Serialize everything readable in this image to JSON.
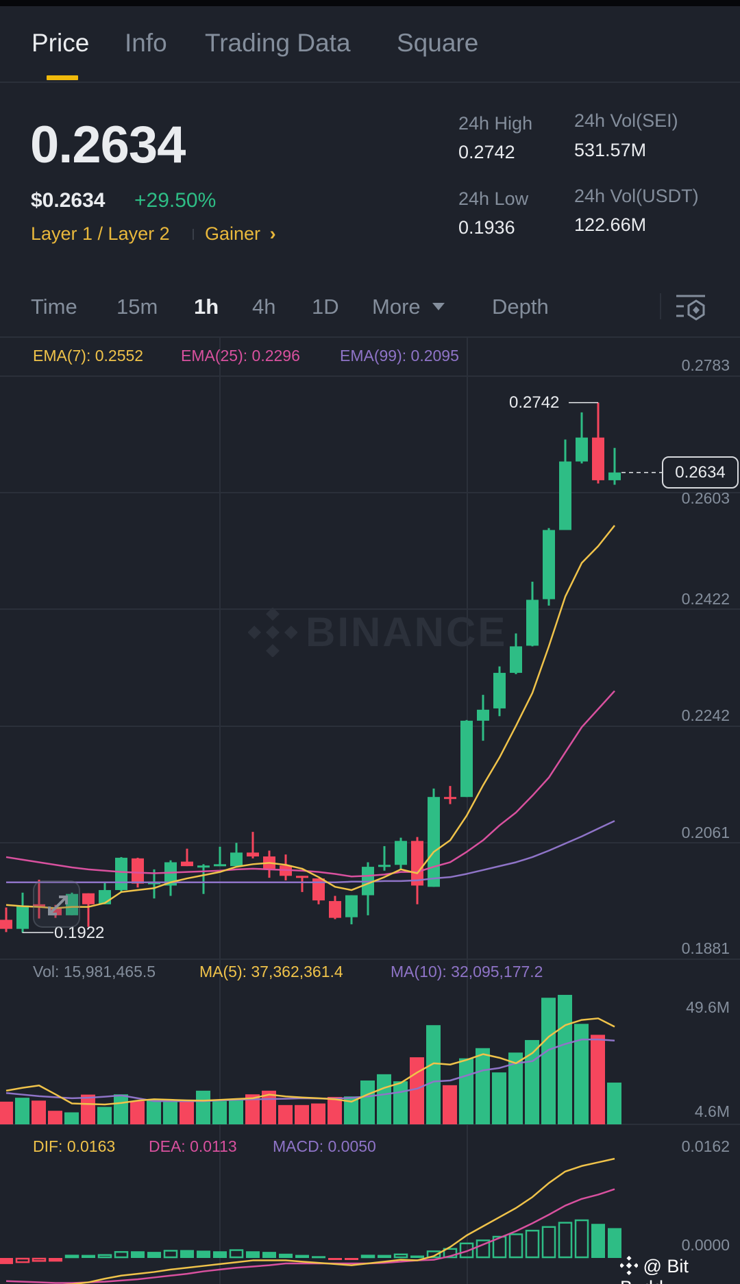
{
  "tabs": [
    {
      "label": "Price",
      "active": true
    },
    {
      "label": "Info"
    },
    {
      "label": "Trading Data"
    },
    {
      "label": "Square"
    }
  ],
  "ticker": {
    "last_price": "0.2634",
    "usd_price": "$0.2634",
    "change_pct": "+29.50%",
    "tag_category": "Layer 1 / Layer 2",
    "tag_gainer": "Gainer",
    "chevron": "›"
  },
  "stats": {
    "high_label": "24h High",
    "high_value": "0.2742",
    "low_label": "24h Low",
    "low_value": "0.1936",
    "vol_base_label": "24h Vol(SEI)",
    "vol_base_value": "531.57M",
    "vol_quote_label": "24h Vol(USDT)",
    "vol_quote_value": "122.66M"
  },
  "timeframes": {
    "time": "Time",
    "m15": "15m",
    "h1": "1h",
    "h4": "4h",
    "d1": "1D",
    "more": "More",
    "depth": "Depth",
    "active": "1h"
  },
  "indicators": {
    "ema7": "EMA(7): 0.2552",
    "ema25": "EMA(25): 0.2296",
    "ema99": "EMA(99): 0.2095",
    "vol": "Vol: 15,981,465.5",
    "ma5": "MA(5): 37,362,361.4",
    "ma10": "MA(10): 32,095,177.2",
    "dif": "DIF: 0.0163",
    "dea": "DEA: 0.0113",
    "macd": "MACD: 0.0050"
  },
  "watermark": "BINANCE",
  "credit": "@ Bit Buddy",
  "colors": {
    "up": "#2ebd85",
    "down": "#f6465d",
    "accent": "#f0b90b",
    "ema7": "#f0c34a",
    "ema25": "#d9519f",
    "ema99": "#8f74c8"
  },
  "chart_data": {
    "type": "candlestick",
    "interval": "1h",
    "y_ticks": [
      "0.2783",
      "0.2603",
      "0.2422",
      "0.2242",
      "0.2061",
      "0.1881"
    ],
    "ylim": [
      0.1881,
      0.2783
    ],
    "high_marker": "0.2742",
    "low_marker": "0.1922",
    "last_price_tag": "0.2634",
    "candles": [
      [
        0.1942,
        0.1961,
        0.1923,
        0.1928
      ],
      [
        0.1928,
        0.1984,
        0.1922,
        0.1964
      ],
      [
        0.1966,
        0.2004,
        0.1944,
        0.1962
      ],
      [
        0.1961,
        0.1965,
        0.1945,
        0.1949
      ],
      [
        0.1949,
        0.1984,
        0.1949,
        0.1982
      ],
      [
        0.1983,
        0.1983,
        0.1931,
        0.1966
      ],
      [
        0.1966,
        0.2,
        0.1966,
        0.1988
      ],
      [
        0.1988,
        0.2039,
        0.1984,
        0.2038
      ],
      [
        0.2037,
        0.2038,
        0.1992,
        0.1998
      ],
      [
        0.1997,
        0.202,
        0.1975,
        0.2001
      ],
      [
        0.1995,
        0.2034,
        0.1979,
        0.2031
      ],
      [
        0.2032,
        0.2052,
        0.2025,
        0.2025
      ],
      [
        0.2023,
        0.2028,
        0.1982,
        0.2026
      ],
      [
        0.2025,
        0.2055,
        0.2025,
        0.2028
      ],
      [
        0.2025,
        0.2061,
        0.2025,
        0.2046
      ],
      [
        0.2046,
        0.2078,
        0.2037,
        0.204
      ],
      [
        0.204,
        0.2049,
        0.2007,
        0.2021
      ],
      [
        0.2026,
        0.2043,
        0.2003,
        0.201
      ],
      [
        0.201,
        0.201,
        0.1985,
        0.2008
      ],
      [
        0.2006,
        0.2006,
        0.1966,
        0.1972
      ],
      [
        0.1971,
        0.1979,
        0.1943,
        0.1945
      ],
      [
        0.1946,
        0.198,
        0.1935,
        0.198
      ],
      [
        0.198,
        0.2031,
        0.1949,
        0.2024
      ],
      [
        0.2024,
        0.2056,
        0.2018,
        0.2027
      ],
      [
        0.2027,
        0.2069,
        0.2019,
        0.2064
      ],
      [
        0.2064,
        0.207,
        0.1966,
        0.1995
      ],
      [
        0.1993,
        0.2145,
        0.1993,
        0.2132
      ],
      [
        0.2132,
        0.2149,
        0.2121,
        0.2131
      ],
      [
        0.2132,
        0.2251,
        0.2132,
        0.225
      ],
      [
        0.225,
        0.229,
        0.2219,
        0.2267
      ],
      [
        0.2269,
        0.2334,
        0.2257,
        0.2324
      ],
      [
        0.2324,
        0.2385,
        0.2322,
        0.2365
      ],
      [
        0.2366,
        0.2465,
        0.2365,
        0.2437
      ],
      [
        0.2438,
        0.2548,
        0.2428,
        0.2545
      ],
      [
        0.2545,
        0.2685,
        0.2545,
        0.2651
      ],
      [
        0.2651,
        0.2727,
        0.2648,
        0.2688
      ],
      [
        0.2688,
        0.2742,
        0.2617,
        0.2622
      ],
      [
        0.2622,
        0.2672,
        0.2615,
        0.2634
      ]
    ],
    "candle_fields": [
      "open",
      "high",
      "low",
      "close"
    ],
    "ema7": [
      0.1965,
      0.1963,
      0.1962,
      0.196,
      0.1962,
      0.1962,
      0.1968,
      0.1985,
      0.1988,
      0.1991,
      0.2,
      0.2006,
      0.2011,
      0.2016,
      0.2024,
      0.2028,
      0.203,
      0.2027,
      0.2021,
      0.2008,
      0.1993,
      0.1988,
      0.1998,
      0.2008,
      0.202,
      0.2014,
      0.2047,
      0.2065,
      0.2103,
      0.215,
      0.2193,
      0.2242,
      0.2293,
      0.2365,
      0.2442,
      0.2494,
      0.252,
      0.2552
    ],
    "ema25": [
      0.2039,
      0.2035,
      0.2031,
      0.2027,
      0.2023,
      0.202,
      0.2018,
      0.2016,
      0.2015,
      0.2014,
      0.2015,
      0.2016,
      0.2017,
      0.2018,
      0.202,
      0.2021,
      0.202,
      0.2019,
      0.2018,
      0.2016,
      0.2013,
      0.2009,
      0.201,
      0.2012,
      0.2016,
      0.2016,
      0.2024,
      0.2031,
      0.2047,
      0.2065,
      0.2088,
      0.2108,
      0.2134,
      0.2162,
      0.2201,
      0.224,
      0.2268,
      0.2296
    ],
    "ema99": [
      0.2,
      0.2,
      0.2,
      0.2,
      0.2,
      0.2,
      0.2,
      0.2,
      0.2,
      0.2,
      0.2,
      0.2,
      0.2,
      0.2,
      0.2,
      0.2,
      0.2,
      0.2,
      0.2,
      0.2,
      0.2,
      0.2001,
      0.2001,
      0.2002,
      0.2002,
      0.2003,
      0.2006,
      0.2008,
      0.2013,
      0.2019,
      0.2025,
      0.2031,
      0.2039,
      0.2049,
      0.206,
      0.2071,
      0.2083,
      0.2095
    ],
    "volume": {
      "unit": "M",
      "y_ticks": [
        "49.6M",
        "4.6M"
      ],
      "values": [
        8.7,
        10.2,
        9.1,
        5.2,
        4.6,
        11.4,
        6.7,
        11.5,
        8.9,
        9.6,
        8.9,
        8.9,
        12.9,
        8.9,
        9.6,
        11.5,
        12.9,
        7.4,
        7.4,
        8.0,
        10.5,
        10.7,
        16.8,
        19.2,
        16.5,
        25.7,
        38.0,
        15.0,
        25.3,
        29.2,
        19.9,
        27.5,
        32.3,
        48.5,
        49.6,
        38.5,
        34.3,
        16.0
      ],
      "ma5": [
        12.9,
        14.0,
        14.9,
        11.5,
        8.0,
        7.8,
        7.6,
        8.2,
        9.1,
        9.6,
        9.4,
        9.2,
        9.1,
        9.4,
        9.7,
        10.0,
        11.4,
        10.7,
        10.3,
        10.0,
        9.6,
        8.7,
        11.5,
        14.0,
        15.9,
        19.9,
        23.4,
        22.9,
        24.7,
        26.9,
        25.5,
        23.4,
        27.3,
        33.6,
        38.0,
        40.0,
        40.6,
        37.4
      ],
      "ma10": [
        12.0,
        11.4,
        10.8,
        10.4,
        10.0,
        10.2,
        10.6,
        11.1,
        10.0,
        8.9,
        8.9,
        8.9,
        8.9,
        9.2,
        9.4,
        9.6,
        9.7,
        9.8,
        10.0,
        9.9,
        9.8,
        10.2,
        10.7,
        11.5,
        12.4,
        13.7,
        16.4,
        16.8,
        18.7,
        20.7,
        21.6,
        23.4,
        24.2,
        28.6,
        30.8,
        32.5,
        32.5,
        32.1
      ]
    },
    "macd": {
      "y_ticks": [
        "0.0162",
        "0.0000"
      ],
      "dif": [
        -0.005,
        -0.0048,
        -0.0046,
        -0.0045,
        -0.0043,
        -0.004,
        -0.0034,
        -0.0029,
        -0.0026,
        -0.0023,
        -0.0019,
        -0.0016,
        -0.0013,
        -0.001,
        -0.0007,
        -0.0004,
        -0.0004,
        -0.0004,
        -0.0006,
        -0.0008,
        -0.001,
        -0.0012,
        -0.0009,
        -0.0006,
        -0.0003,
        -0.0004,
        0.0003,
        0.0018,
        0.0037,
        0.0052,
        0.0067,
        0.0082,
        0.01,
        0.0123,
        0.0142,
        0.0151,
        0.0157,
        0.0163
      ],
      "dea": [
        -0.0038,
        -0.0039,
        -0.004,
        -0.0041,
        -0.0041,
        -0.004,
        -0.0039,
        -0.0037,
        -0.0035,
        -0.0032,
        -0.0029,
        -0.0026,
        -0.0022,
        -0.0019,
        -0.0016,
        -0.0014,
        -0.0012,
        -0.0009,
        -0.0009,
        -0.0009,
        -0.0009,
        -0.0009,
        -0.0009,
        -0.0008,
        -0.0006,
        -0.0004,
        -0.0003,
        0.0003,
        0.0011,
        0.0022,
        0.0033,
        0.0044,
        0.0057,
        0.0071,
        0.0086,
        0.0097,
        0.0104,
        0.0113
      ],
      "hist": [
        -0.001,
        -0.0008,
        -0.0006,
        -0.0006,
        0.0005,
        0.0005,
        0.0006,
        0.0011,
        0.0011,
        0.001,
        0.0013,
        0.0013,
        0.0012,
        0.0011,
        0.0014,
        0.0011,
        0.001,
        0.0007,
        0.0005,
        0.0003,
        -0.0003,
        -0.0003,
        0.0005,
        0.0005,
        0.0007,
        0.0004,
        0.0012,
        0.0016,
        0.0025,
        0.003,
        0.0036,
        0.004,
        0.0046,
        0.0052,
        0.0059,
        0.0063,
        0.0056,
        0.0049
      ]
    }
  }
}
